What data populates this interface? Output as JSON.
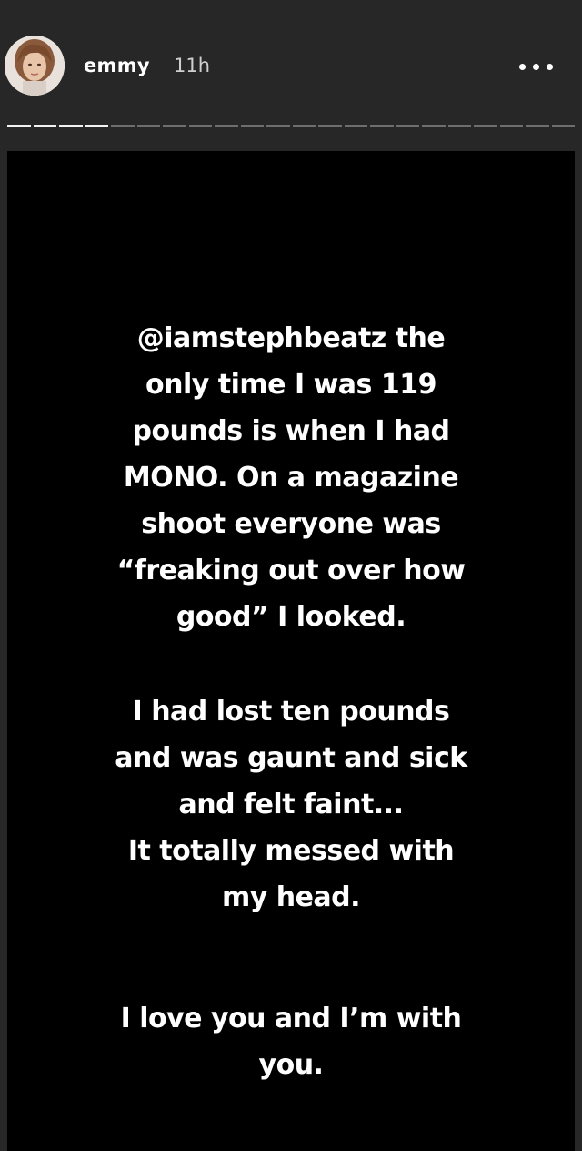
{
  "header": {
    "username": "emmy",
    "timestamp": "11h",
    "avatar": "profile-photo",
    "more_icon": "more-options-icon",
    "progress": {
      "segments_total": 22,
      "segments_viewed": 4
    }
  },
  "story": {
    "background": "#000000",
    "paragraphs": [
      "@iamstephbeatz  the\nonly time I was 119\npounds is when I had\nMONO. On  a magazine\nshoot everyone was\n“freaking out over how\ngood” I looked.",
      "I had lost ten pounds\nand was gaunt and sick\nand felt faint...\nIt totally messed with\nmy head.",
      "I love you and I’m with\nyou."
    ]
  }
}
